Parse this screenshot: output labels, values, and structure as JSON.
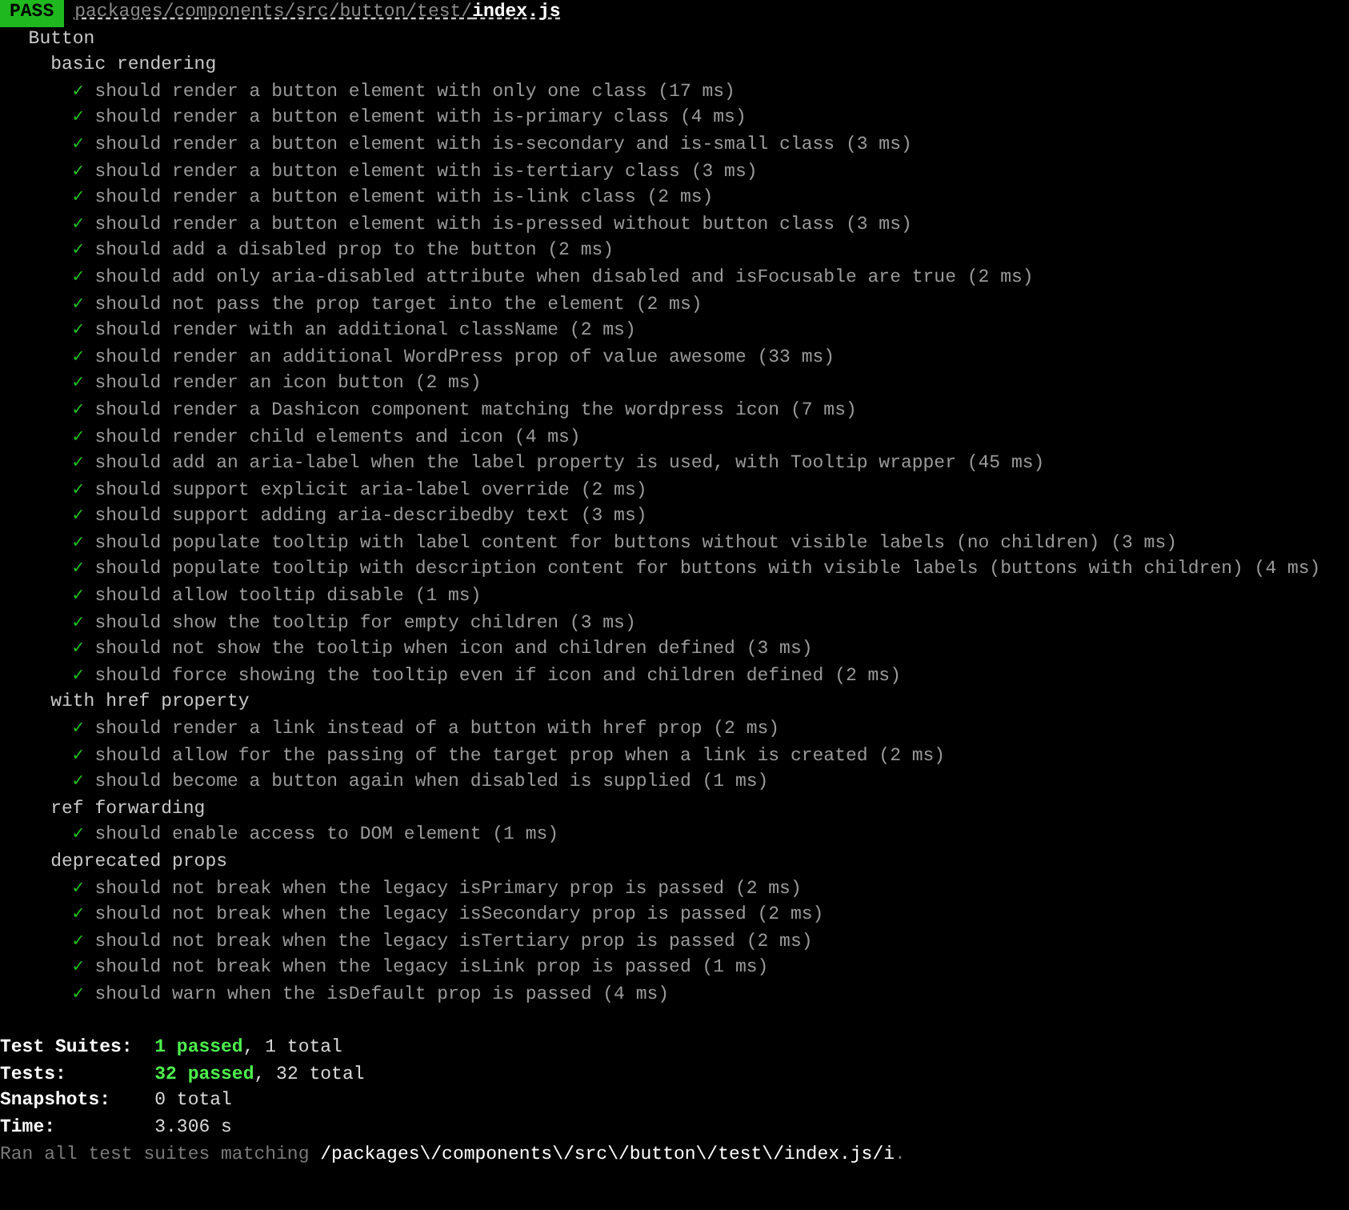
{
  "header": {
    "status": "PASS",
    "path": "packages/components/src/button/test/",
    "file": "index.js"
  },
  "suite": {
    "title": "Button",
    "groups": [
      {
        "title": "basic rendering",
        "tests": [
          {
            "check": "✓",
            "name": "should render a button element with only one class (17 ms)"
          },
          {
            "check": "✓",
            "name": "should render a button element with is-primary class (4 ms)"
          },
          {
            "check": "✓",
            "name": "should render a button element with is-secondary and is-small class (3 ms)"
          },
          {
            "check": "✓",
            "name": "should render a button element with is-tertiary class (3 ms)"
          },
          {
            "check": "✓",
            "name": "should render a button element with is-link class (2 ms)"
          },
          {
            "check": "✓",
            "name": "should render a button element with is-pressed without button class (3 ms)"
          },
          {
            "check": "✓",
            "name": "should add a disabled prop to the button (2 ms)"
          },
          {
            "check": "✓",
            "name": "should add only aria-disabled attribute when disabled and isFocusable are true (2 ms)"
          },
          {
            "check": "✓",
            "name": "should not pass the prop target into the element (2 ms)"
          },
          {
            "check": "✓",
            "name": "should render with an additional className (2 ms)"
          },
          {
            "check": "✓",
            "name": "should render an additional WordPress prop of value awesome (33 ms)"
          },
          {
            "check": "✓",
            "name": "should render an icon button (2 ms)"
          },
          {
            "check": "✓",
            "name": "should render a Dashicon component matching the wordpress icon (7 ms)"
          },
          {
            "check": "✓",
            "name": "should render child elements and icon (4 ms)"
          },
          {
            "check": "✓",
            "name": "should add an aria-label when the label property is used, with Tooltip wrapper (45 ms)"
          },
          {
            "check": "✓",
            "name": "should support explicit aria-label override (2 ms)"
          },
          {
            "check": "✓",
            "name": "should support adding aria-describedby text (3 ms)"
          },
          {
            "check": "✓",
            "name": "should populate tooltip with label content for buttons without visible labels (no children) (3 ms)"
          },
          {
            "check": "✓",
            "name": "should populate tooltip with description content for buttons with visible labels (buttons with children) (4 ms)"
          },
          {
            "check": "✓",
            "name": "should allow tooltip disable (1 ms)"
          },
          {
            "check": "✓",
            "name": "should show the tooltip for empty children (3 ms)"
          },
          {
            "check": "✓",
            "name": "should not show the tooltip when icon and children defined (3 ms)"
          },
          {
            "check": "✓",
            "name": "should force showing the tooltip even if icon and children defined (2 ms)"
          }
        ]
      },
      {
        "title": "with href property",
        "tests": [
          {
            "check": "✓",
            "name": "should render a link instead of a button with href prop (2 ms)"
          },
          {
            "check": "✓",
            "name": "should allow for the passing of the target prop when a link is created (2 ms)"
          },
          {
            "check": "✓",
            "name": "should become a button again when disabled is supplied (1 ms)"
          }
        ]
      },
      {
        "title": "ref forwarding",
        "tests": [
          {
            "check": "✓",
            "name": "should enable access to DOM element (1 ms)"
          }
        ]
      },
      {
        "title": "deprecated props",
        "tests": [
          {
            "check": "✓",
            "name": "should not break when the legacy isPrimary prop is passed (2 ms)"
          },
          {
            "check": "✓",
            "name": "should not break when the legacy isSecondary prop is passed (2 ms)"
          },
          {
            "check": "✓",
            "name": "should not break when the legacy isTertiary prop is passed (2 ms)"
          },
          {
            "check": "✓",
            "name": "should not break when the legacy isLink prop is passed (1 ms)"
          },
          {
            "check": "✓",
            "name": "should warn when the isDefault prop is passed (4 ms)"
          }
        ]
      }
    ]
  },
  "summary": [
    {
      "label": "Test Suites:",
      "passed": "1 passed",
      "rest": ", 1 total"
    },
    {
      "label": "Tests:",
      "passed": "32 passed",
      "rest": ", 32 total"
    },
    {
      "label": "Snapshots:",
      "rest": "0 total"
    },
    {
      "label": "Time:",
      "rest": "3.306 s"
    }
  ],
  "footer": {
    "prefix": "Ran all test suites matching ",
    "pattern": "/packages\\/components\\/src\\/button\\/test\\/index.js/i",
    "suffix": "."
  }
}
